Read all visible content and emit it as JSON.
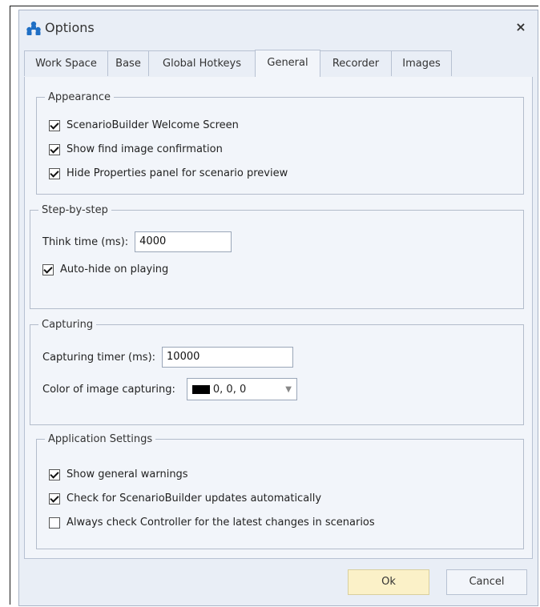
{
  "window": {
    "title": "Options",
    "close_glyph": "×"
  },
  "tabs": [
    {
      "label": "Work Space",
      "active": false
    },
    {
      "label": "Base",
      "active": false
    },
    {
      "label": "Global Hotkeys",
      "active": false
    },
    {
      "label": "General",
      "active": true
    },
    {
      "label": "Recorder",
      "active": false
    },
    {
      "label": "Images",
      "active": false
    }
  ],
  "appearance": {
    "title": "Appearance",
    "items": [
      {
        "label": "ScenarioBuilder Welcome Screen",
        "checked": true
      },
      {
        "label": "Show find image confirmation",
        "checked": true
      },
      {
        "label": "Hide Properties panel for scenario preview",
        "checked": true
      }
    ]
  },
  "step": {
    "title": "Step-by-step",
    "think_label": "Think time (ms):",
    "think_value": "4000",
    "autohide_label": "Auto-hide on playing",
    "autohide_checked": true
  },
  "capturing": {
    "title": "Capturing",
    "timer_label": "Capturing timer (ms):",
    "timer_value": "10000",
    "color_label": "Color of image capturing:",
    "color_value": "0, 0, 0",
    "color_swatch": "#000000"
  },
  "app_settings": {
    "title": "Application Settings",
    "items": [
      {
        "label": "Show general warnings",
        "checked": true
      },
      {
        "label": "Check for ScenarioBuilder updates automatically",
        "checked": true
      },
      {
        "label": "Always check Controller for the latest changes in scenarios",
        "checked": false
      }
    ]
  },
  "buttons": {
    "ok": "Ok",
    "cancel": "Cancel"
  },
  "colors": {
    "dialog_bg": "#e9eef6",
    "panel_bg": "#f2f5fa",
    "ok_bg": "#fbf1c8",
    "icon_blue": "#1f6fc5"
  },
  "icons": {
    "app": "people-group-icon",
    "close": "close-icon",
    "dropdown": "chevron-down-icon"
  }
}
